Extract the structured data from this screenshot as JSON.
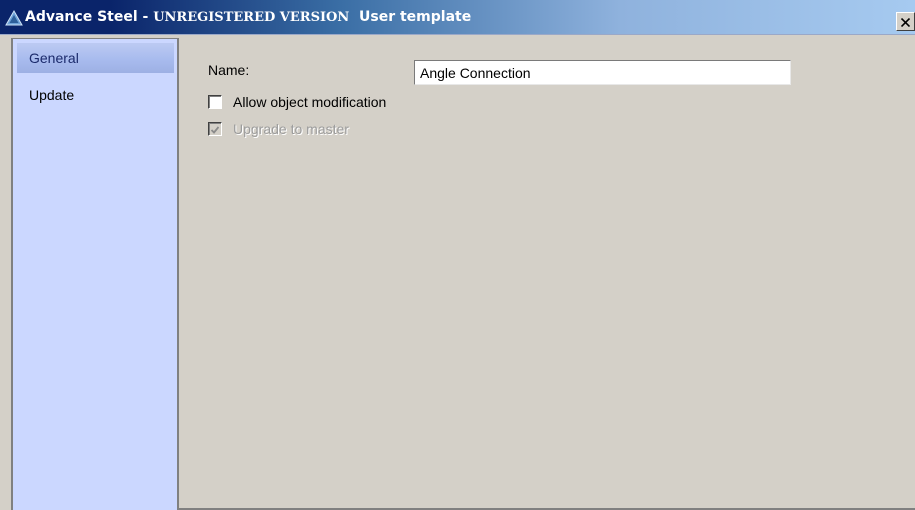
{
  "window": {
    "title_app": "Advance Steel - ",
    "title_reg": "UNREGISTERED VERSION",
    "title_dialog": "User template",
    "close_symbol": "×"
  },
  "sidebar": {
    "items": [
      {
        "label": "General",
        "selected": true
      },
      {
        "label": "Update",
        "selected": false
      }
    ]
  },
  "general": {
    "name_label": "Name:",
    "name_value": "Angle Connection",
    "allow_modification_label": "Allow object modification",
    "allow_modification_checked": false,
    "upgrade_master_label": "Upgrade to master",
    "upgrade_master_checked": true,
    "upgrade_master_enabled": false
  },
  "icons": {
    "app_icon": "advance-steel-icon",
    "close_icon": "close-icon",
    "check_icon": "checkmark-icon"
  },
  "colors": {
    "sidebar_bg": "#cbd7ff",
    "selected_item": "#a8bbee",
    "dialog_bg": "#d4d0c8",
    "title_dark": "#0a246a",
    "title_light": "#a6caf0"
  }
}
